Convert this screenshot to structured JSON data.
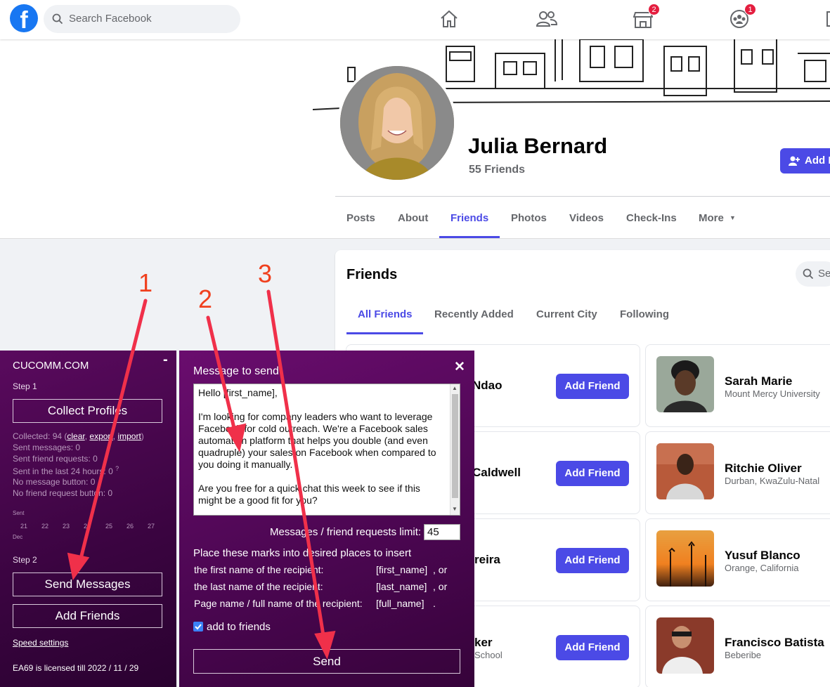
{
  "topbar": {
    "search_placeholder": "Search Facebook",
    "marketplace_badge": "2",
    "groups_badge": "1"
  },
  "profile": {
    "name": "Julia Bernard",
    "friends_count": "55 Friends",
    "add_button": "Add F"
  },
  "tabs": [
    "Posts",
    "About",
    "Friends",
    "Photos",
    "Videos",
    "Check-Ins",
    "More"
  ],
  "friends": {
    "title": "Friends",
    "search_placeholder": "Se",
    "subtabs": [
      "All Friends",
      "Recently Added",
      "Current City",
      "Following"
    ],
    "add_label": "Add Friend",
    "left_names": [
      "Ndao",
      "Caldwell",
      "reira",
      "ker"
    ],
    "left_subs": [
      "",
      "",
      "",
      "School"
    ],
    "right": [
      {
        "name": "Sarah Marie",
        "sub": "Mount Mercy University"
      },
      {
        "name": "Ritchie Oliver",
        "sub": "Durban, KwaZulu-Natal"
      },
      {
        "name": "Yusuf Blanco",
        "sub": "Orange, California"
      },
      {
        "name": "Francisco Batista",
        "sub": "Beberibe"
      }
    ]
  },
  "ext": {
    "brand": "CUCOMM.COM",
    "minimize": "-",
    "step1": "Step 1",
    "collect": "Collect Profiles",
    "collected_prefix": "Collected: 94 (",
    "clear": "clear",
    "comma1": ", ",
    "export": "export",
    "comma2": ", ",
    "import": "import",
    "collected_suffix": ")",
    "sent_messages": "Sent messages: 0",
    "sent_requests": "Sent friend requests: 0",
    "sent_24h": "Sent in the last 24 hours: 0",
    "help_mark": "?",
    "no_message": "No message button: 0",
    "no_request": "No friend request button: 0",
    "chart_sent": "Sent",
    "chart_days": [
      "21",
      "22",
      "23",
      "24",
      "25",
      "26",
      "27"
    ],
    "chart_month": "Dec",
    "step2": "Step 2",
    "send_messages": "Send Messages",
    "add_friends": "Add Friends",
    "speed": "Speed settings",
    "license": "EA69 is licensed till 2022 / 11 / 29"
  },
  "msg": {
    "title": "Message to send",
    "close": "✕",
    "text": "Hello [first_name],\n\nI'm looking for company leaders who want to leverage Facebook for cold outreach. We're a Facebook sales automation platform that helps you double (and even quadruple) your sales on Facebook when compared to you doing it manually.\n\nAre you free for a quick chat this week to see if this might be a good fit for you?",
    "limit_label": "Messages / friend requests limit:",
    "limit_value": "45",
    "marks_intro": "Place these marks into desired places to insert",
    "mark_rows": [
      {
        "label": "the first name of the recipient:",
        "token": "[first_name]",
        "sep": ", or"
      },
      {
        "label": "the last name of the recipient:",
        "token": "[last_name]",
        "sep": ", or"
      },
      {
        "label": "Page name / full name of the recipient:",
        "token": "[full_name]",
        "sep": "."
      }
    ],
    "add_to_friends": "add to friends",
    "send": "Send"
  },
  "annotations": [
    "1",
    "2",
    "3"
  ],
  "colors": {
    "accent": "#4b4ae6",
    "facebook": "#1877f2",
    "annotation": "#f0401e",
    "panel": "#4a0650"
  }
}
